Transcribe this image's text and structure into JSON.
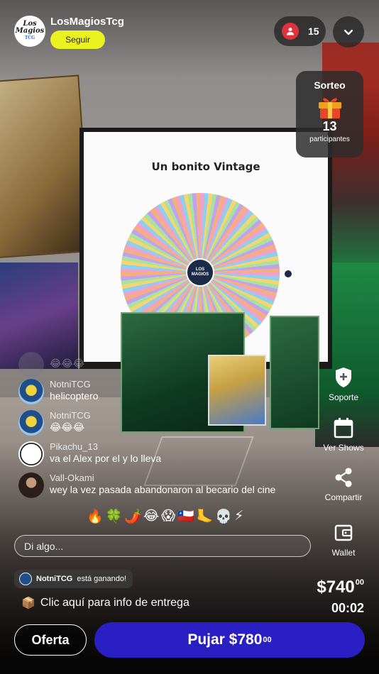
{
  "header": {
    "streamer_name": "LosMagiosTcg",
    "avatar_logo_top": "Los Magios",
    "avatar_logo_bottom": "TCG",
    "follow_label": "Seguir",
    "viewers_count": "15"
  },
  "scene": {
    "screen_title": "Un bonito Vintage",
    "wheel_center_label": "LOS MAGIOS"
  },
  "sorteo": {
    "title": "Sorteo",
    "count": "13",
    "subtitle": "participantes",
    "icon": "gift-icon"
  },
  "side_actions": [
    {
      "label": "Soporte",
      "icon": "support-shield-icon"
    },
    {
      "label": "Ver Shows",
      "icon": "calendar-icon"
    },
    {
      "label": "Compartir",
      "icon": "share-icon"
    },
    {
      "label": "Wallet",
      "icon": "wallet-icon"
    }
  ],
  "chat": [
    {
      "user": "",
      "text": "😂😂😂",
      "faded": true
    },
    {
      "user": "NotniTCG",
      "text": "helicoptero"
    },
    {
      "user": "NotniTCG",
      "text": "😂😂😂"
    },
    {
      "user": "Pikachu_13",
      "text": "va el Alex por el y lo lleva"
    },
    {
      "user": "Vall-Okami",
      "text": "wey la vez pasada abandonaron al becario del cine"
    }
  ],
  "emoji_reactions": [
    "🔥",
    "🍀",
    "🌶️",
    "😂",
    "😱",
    "🇨🇱",
    "🦶",
    "💀",
    "⚡"
  ],
  "chat_input": {
    "placeholder": "Di algo..."
  },
  "auction": {
    "winner_name": "NotniTCG",
    "winner_suffix": "está ganando!",
    "delivery_emoji": "📦",
    "delivery_text": "Clic aquí para info de entrega",
    "price_main": "$740",
    "price_cents": "00",
    "timer": "00:02",
    "offer_label": "Oferta",
    "bid_label": "Pujar $780",
    "bid_cents": "00"
  },
  "colors": {
    "follow_button": "#eaf21f",
    "bid_button": "#2a1fc2",
    "viewer_badge": "#e0313f"
  }
}
